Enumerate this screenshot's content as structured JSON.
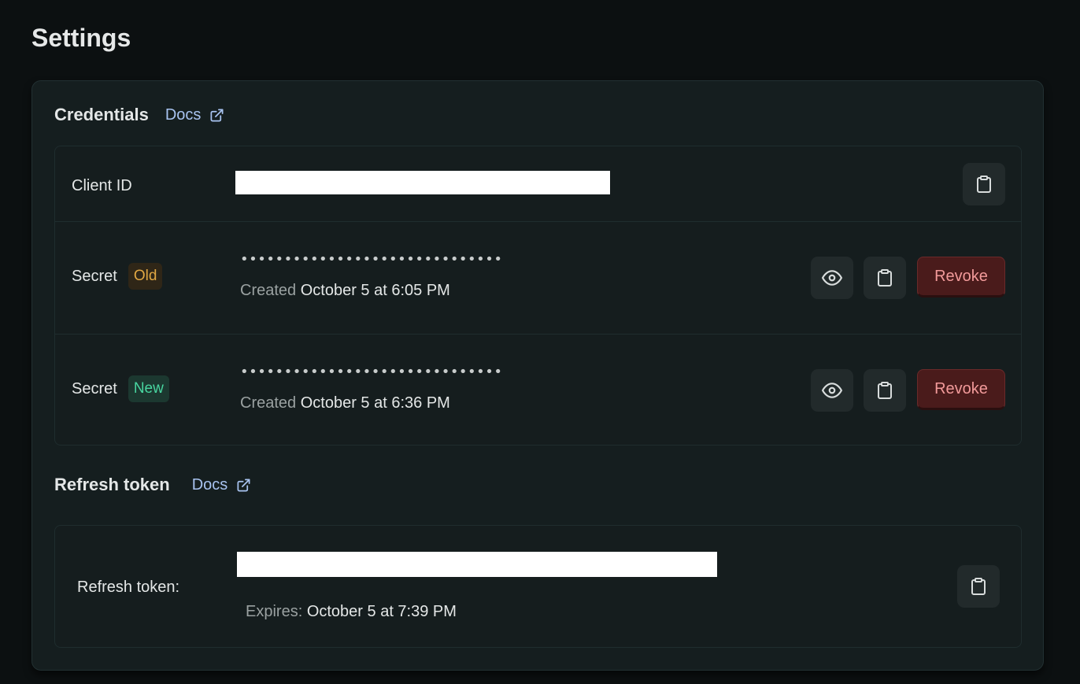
{
  "page": {
    "title": "Settings"
  },
  "credentials": {
    "title": "Credentials",
    "docs_label": "Docs",
    "client_id": {
      "label": "Client ID"
    },
    "secrets": [
      {
        "label": "Secret",
        "badge": "Old",
        "masked_value": "••••••••••••••••••••••••••••••",
        "created_label": "Created",
        "created_value": "October 5 at 6:05 PM",
        "revoke_label": "Revoke"
      },
      {
        "label": "Secret",
        "badge": "New",
        "masked_value": "••••••••••••••••••••••••••••••",
        "created_label": "Created",
        "created_value": "October 5 at 6:36 PM",
        "revoke_label": "Revoke"
      }
    ]
  },
  "refresh_token": {
    "title": "Refresh token",
    "docs_label": "Docs",
    "label": "Refresh token:",
    "expires_label": "Expires:",
    "expires_value": "October 5 at 7:39 PM"
  },
  "colors": {
    "background": "#0c1011",
    "panel": "#151e1f",
    "link": "#a8c3f0",
    "badge_old": "#e0a743",
    "badge_new": "#48d6a0",
    "revoke_bg": "#4a1b1b",
    "revoke_text": "#f29a9a"
  },
  "icons": {
    "external_link": "external-link-icon",
    "copy": "clipboard-icon",
    "reveal": "eye-icon"
  }
}
